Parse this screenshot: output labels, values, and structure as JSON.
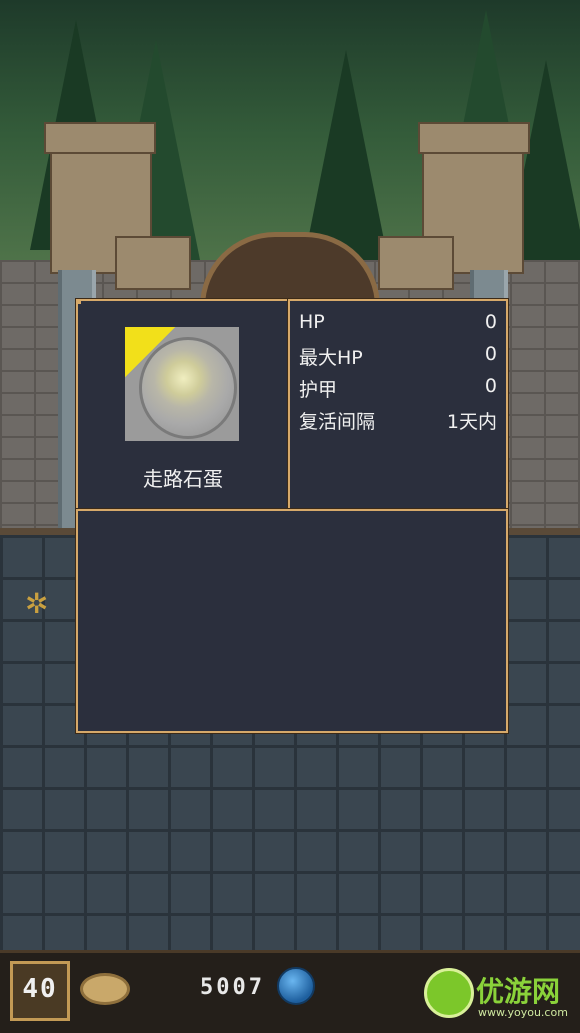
{
  "monster": {
    "name": "走路石蛋",
    "stats": [
      {
        "label": "HP",
        "value": "0"
      },
      {
        "label": "最大HP",
        "value": "0"
      },
      {
        "label": "护甲",
        "value": "0"
      },
      {
        "label": "复活间隔",
        "value": "1天内"
      }
    ],
    "description": ""
  },
  "hud": {
    "level": "40",
    "gold": "5007"
  },
  "watermark": {
    "text": "优游网",
    "sub": "www.yoyou.com"
  },
  "colors": {
    "panel_bg": "#2b2f3d",
    "panel_border": "#d6a96a",
    "egg_yellow": "#f2e01a"
  },
  "icons": [
    "coin-icon",
    "gem-icon",
    "level-badge-icon",
    "watermark-logo-icon"
  ]
}
